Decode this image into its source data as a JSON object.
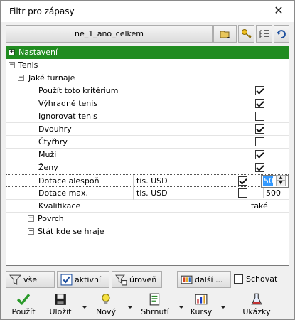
{
  "window": {
    "title": "Filtr pro zápasy",
    "close_glyph": "✕"
  },
  "toolbar": {
    "profile_name": "ne_1_ano_celkem",
    "buttons": [
      {
        "icon": "folder-dropdown-icon"
      },
      {
        "icon": "key-icon"
      },
      {
        "icon": "list-tree-icon"
      },
      {
        "icon": "undo-arrow-icon"
      }
    ]
  },
  "tree": {
    "nastaveni": {
      "expander": "+",
      "label": "Nastavení"
    },
    "tenis": {
      "expander": "−",
      "label": "Tenis"
    },
    "jake_turnaje": {
      "expander": "−",
      "label": "Jaké turnaje"
    },
    "props": [
      {
        "label": "Použít toto kritérium",
        "checked": true
      },
      {
        "label": "Výhradně tenis",
        "checked": true
      },
      {
        "label": "Ignorovat tenis",
        "checked": false
      },
      {
        "label": "Dvouhry",
        "checked": true
      },
      {
        "label": "Čtyřhry",
        "checked": false
      },
      {
        "label": "Muži",
        "checked": true
      },
      {
        "label": "Ženy",
        "checked": true
      }
    ],
    "dotace_alespon": {
      "label": "Dotace alespoň",
      "unit": "tis. USD",
      "checked": true,
      "value": "50"
    },
    "dotace_max": {
      "label": "Dotace max.",
      "unit": "tis. USD",
      "checked": false,
      "value": "500"
    },
    "kvalifikace": {
      "label": "Kvalifikace",
      "value": "také"
    },
    "povrch": {
      "expander": "+",
      "label": "Povrch"
    },
    "stat": {
      "expander": "+",
      "label": "Stát kde se hraje"
    }
  },
  "filterbar": {
    "vse": "vše",
    "aktivni": "aktivní",
    "uroven": "úroveň",
    "dalsi": "další ...",
    "schovat": "Schovat",
    "schovat_checked": false
  },
  "bottombar": {
    "pouzit": "Použít",
    "ulozit": "Uložit",
    "novy": "Nový",
    "shrnuti": "Shrnutí",
    "kursy": "Kursy",
    "ukazky": "Ukázky"
  },
  "colors": {
    "section_green": "#218c21",
    "selection_blue": "#3399ff"
  }
}
